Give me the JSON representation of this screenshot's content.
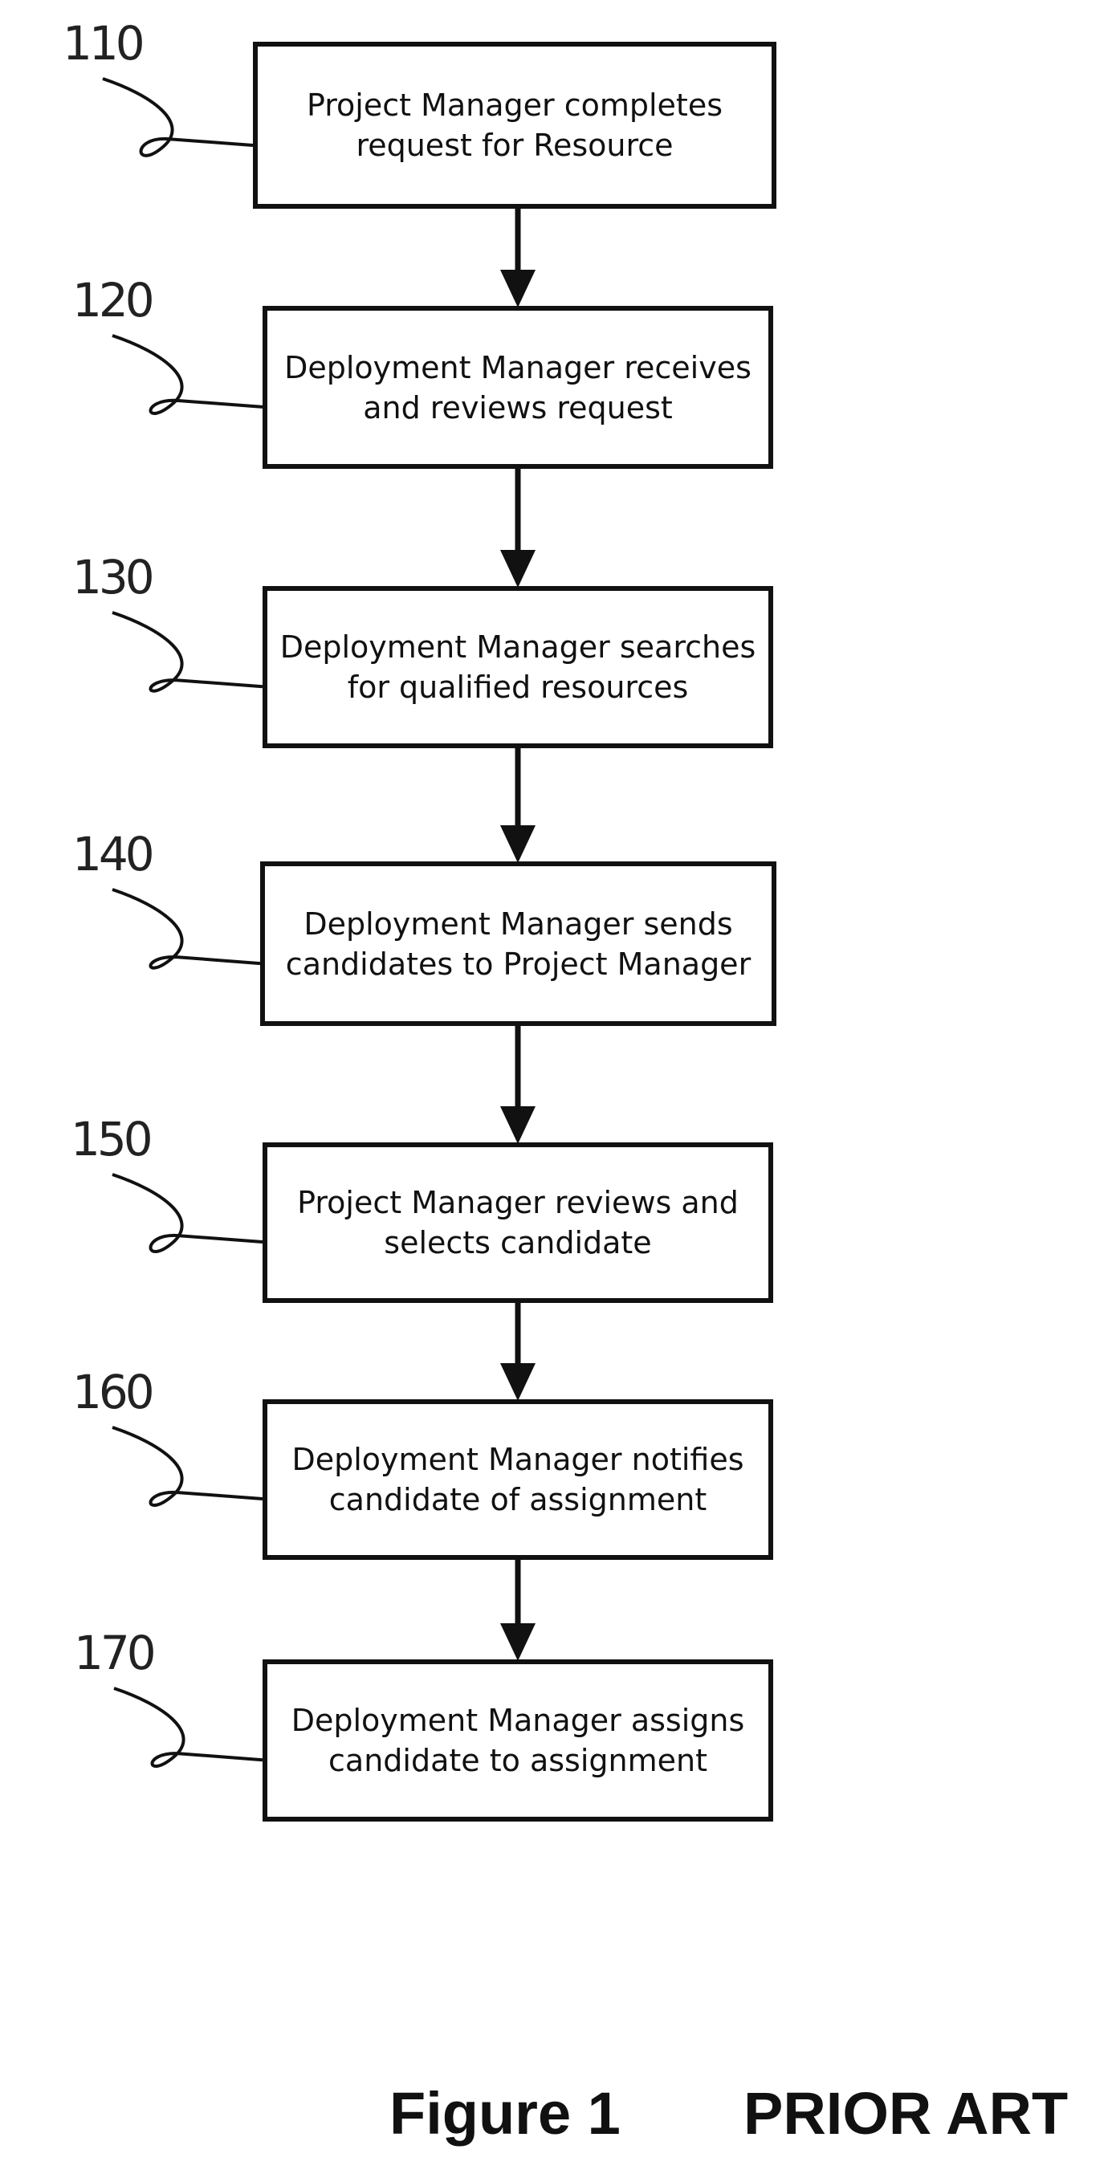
{
  "figure": {
    "title": "Figure 1",
    "tag": "PRIOR ART"
  },
  "steps": [
    {
      "ref": "110",
      "text": "Project Manager completes request for Resource"
    },
    {
      "ref": "120",
      "text": "Deployment Manager receives and reviews request"
    },
    {
      "ref": "130",
      "text": "Deployment Manager searches for qualified resources"
    },
    {
      "ref": "140",
      "text": "Deployment Manager sends candidates to Project Manager"
    },
    {
      "ref": "150",
      "text": "Project Manager reviews and selects candidate"
    },
    {
      "ref": "160",
      "text": "Deployment Manager notifies candidate of assignment"
    },
    {
      "ref": "170",
      "text": "Deployment Manager assigns candidate to assignment"
    }
  ]
}
